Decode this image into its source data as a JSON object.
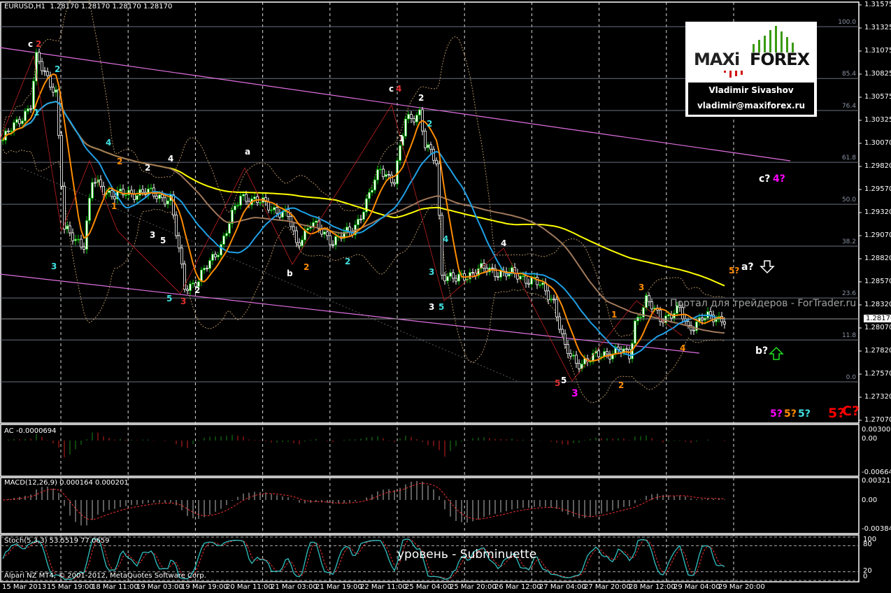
{
  "header": {
    "symbol": "EURUSD,H1",
    "ohlc": "1.28170 1.28170 1.28170 1.28170"
  },
  "colors": {
    "bull": "#00c000",
    "bear": "#ffffff",
    "ma_fast": "#ff8c00",
    "ma_mid": "#1ea0e6",
    "ma_slow": "#a0785a",
    "ma_long": "#ffff00",
    "channel": "#e070e0",
    "fib": "#5a6270",
    "grid": "#cccccc"
  },
  "chart_data": {
    "type": "candlestick",
    "title": "EURUSD,H1",
    "ylim": [
      1.2707,
      1.31575
    ],
    "y_ticks": [
      "1.31575",
      "1.31325",
      "1.31075",
      "1.30825",
      "1.30575",
      "1.30325",
      "1.30070",
      "1.29820",
      "1.29570",
      "1.29320",
      "1.29070",
      "1.28820",
      "1.28570",
      "1.28320",
      "1.28070",
      "1.27820",
      "1.27570",
      "1.27320",
      "1.27070"
    ],
    "current_price": "1.28170",
    "x_ticks": [
      "15 Mar 2013",
      "15 Mar 19:00",
      "18 Mar 11:00",
      "19 Mar 03:00",
      "19 Mar 19:00",
      "20 Mar 11:00",
      "21 Mar 03:00",
      "21 Mar 19:00",
      "22 Mar 11:00",
      "25 Mar 04:00",
      "25 Mar 20:00",
      "26 Mar 12:00",
      "27 Mar 04:00",
      "27 Mar 20:00",
      "28 Mar 12:00",
      "29 Mar 04:00",
      "29 Mar 20:00"
    ],
    "close_anchors": [
      [
        0,
        1.301
      ],
      [
        10,
        1.3048
      ],
      [
        12,
        1.3098
      ],
      [
        19,
        1.3063
      ],
      [
        22,
        1.2912
      ],
      [
        29,
        1.2897
      ],
      [
        32,
        1.2965
      ],
      [
        40,
        1.295
      ],
      [
        50,
        1.2954
      ],
      [
        60,
        1.2946
      ],
      [
        65,
        1.2851
      ],
      [
        70,
        1.2858
      ],
      [
        78,
        1.2897
      ],
      [
        85,
        1.295
      ],
      [
        95,
        1.2939
      ],
      [
        102,
        1.2927
      ],
      [
        105,
        1.2897
      ],
      [
        110,
        1.292
      ],
      [
        118,
        1.2901
      ],
      [
        125,
        1.2912
      ],
      [
        130,
        1.2942
      ],
      [
        135,
        1.298
      ],
      [
        140,
        1.2965
      ],
      [
        144,
        1.3033
      ],
      [
        149,
        1.304
      ],
      [
        151,
        1.3003
      ],
      [
        155,
        1.2987
      ],
      [
        157,
        1.2866
      ],
      [
        162,
        1.2858
      ],
      [
        170,
        1.287
      ],
      [
        180,
        1.2866
      ],
      [
        190,
        1.2858
      ],
      [
        197,
        1.2836
      ],
      [
        201,
        1.2783
      ],
      [
        205,
        1.2768
      ],
      [
        212,
        1.2775
      ],
      [
        220,
        1.2783
      ],
      [
        224,
        1.2775
      ],
      [
        226,
        1.2813
      ],
      [
        230,
        1.2836
      ],
      [
        235,
        1.2817
      ],
      [
        242,
        1.2825
      ],
      [
        245,
        1.2806
      ],
      [
        250,
        1.2817
      ],
      [
        258,
        1.2817
      ]
    ],
    "fib_levels": [
      {
        "label": "100.0",
        "price": 1.31331
      },
      {
        "label": "85.4",
        "price": 1.30769
      },
      {
        "label": "76.4",
        "price": 1.30422
      },
      {
        "label": "61.8",
        "price": 1.2986
      },
      {
        "label": "50.0",
        "price": 1.29405
      },
      {
        "label": "38.2",
        "price": 1.28951
      },
      {
        "label": "23.6",
        "price": 1.28389
      },
      {
        "label": "11.8",
        "price": 1.27934
      },
      {
        "label": "0.0",
        "price": 1.2748
      }
    ],
    "indicators": {
      "ac": {
        "label": "AC -0.0000694",
        "ticks": [
          "0.003006",
          "0.00",
          "-0.006643"
        ]
      },
      "macd": {
        "label": "MACD(12,26,9) 0.000164 0.000201",
        "ticks": [
          "0.003217",
          "0.00",
          "-0.003843"
        ]
      },
      "stoch": {
        "label": "Stoch(5,3,3) 53.5519 77.0659",
        "ticks": [
          "100",
          "80",
          "20",
          "0"
        ]
      }
    }
  },
  "wave_labels": [
    {
      "t": "c",
      "c": "#ffffff"
    },
    {
      "t": "2",
      "c": "#e03030"
    },
    {
      "t": "2",
      "c": "#40e0e0"
    },
    {
      "t": "1",
      "c": "#40e0e0"
    },
    {
      "t": "3",
      "c": "#40e0e0"
    },
    {
      "t": "4",
      "c": "#40e0e0"
    },
    {
      "t": "2",
      "c": "#ff8c00"
    },
    {
      "t": "1",
      "c": "#ff8c00"
    },
    {
      "t": "2",
      "c": "#ffffff"
    },
    {
      "t": "4",
      "c": "#ffffff"
    },
    {
      "t": "3",
      "c": "#ffffff"
    },
    {
      "t": "5",
      "c": "#ffffff"
    },
    {
      "t": "5",
      "c": "#40e0e0"
    },
    {
      "t": "3",
      "c": "#e03030"
    },
    {
      "t": "2",
      "c": "#ffffff"
    },
    {
      "t": "a",
      "c": "#ffffff"
    },
    {
      "t": "b",
      "c": "#ffffff"
    },
    {
      "t": "2",
      "c": "#ff8c00"
    },
    {
      "t": "2",
      "c": "#40e0e0"
    },
    {
      "t": "c",
      "c": "#ffffff"
    },
    {
      "t": "4",
      "c": "#e03030"
    },
    {
      "t": "2",
      "c": "#ffffff"
    },
    {
      "t": "2",
      "c": "#40e0e0"
    },
    {
      "t": "1",
      "c": "#ffffff"
    },
    {
      "t": "4",
      "c": "#40e0e0"
    },
    {
      "t": "3",
      "c": "#40e0e0"
    },
    {
      "t": "3",
      "c": "#ffffff"
    },
    {
      "t": "5",
      "c": "#40e0e0"
    },
    {
      "t": "4",
      "c": "#ffffff"
    },
    {
      "t": "5",
      "c": "#e03030"
    },
    {
      "t": "5",
      "c": "#ffffff"
    },
    {
      "t": "3",
      "c": "#ff00ff"
    },
    {
      "t": "2",
      "c": "#ff8c00"
    },
    {
      "t": "1",
      "c": "#ff8c00"
    },
    {
      "t": "3",
      "c": "#ff8c00"
    },
    {
      "t": "4",
      "c": "#ff8c00"
    },
    {
      "t": "c?",
      "c": "#ffffff"
    },
    {
      "t": "4?",
      "c": "#ff00ff"
    },
    {
      "t": "5?",
      "c": "#ff8c00"
    },
    {
      "t": "a?",
      "c": "#ffffff"
    },
    {
      "t": "b?",
      "c": "#ffffff"
    },
    {
      "t": "5?",
      "c": "#ff00ff"
    },
    {
      "t": "5?",
      "c": "#ff8c00"
    },
    {
      "t": "5?",
      "c": "#40e0e0"
    },
    {
      "t": "5?",
      "c": "#ff0000"
    },
    {
      "t": "C?",
      "c": "#ff0000"
    }
  ],
  "watermark": "Портал для трейдеров - ForTrader.ru",
  "caption": "уровень - Subminuette",
  "copyright": "Alpari NZ MT4, © 2001-2012, MetaQuotes Software Corp.",
  "logo": {
    "brand_left": "MAXi",
    "brand_right": "FOREX",
    "author": "Vladimir Sivashov",
    "email": "vladimir@maxiforex.ru"
  }
}
